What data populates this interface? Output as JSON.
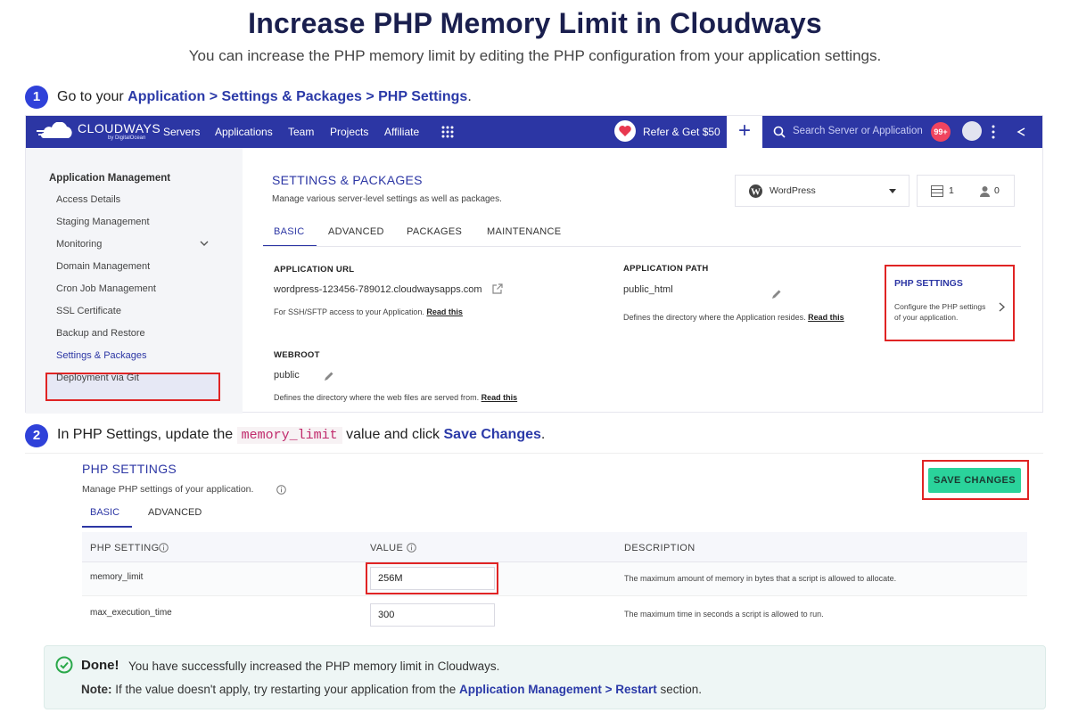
{
  "header": {
    "title": "Increase PHP Memory Limit in Cloudways",
    "subtitle": "You can increase the PHP memory limit by editing the PHP configuration from your application settings."
  },
  "step1": {
    "number": "1",
    "text_prefix": "Go to your ",
    "path": "Application > Settings & Packages > PHP Settings",
    "text_suffix": "."
  },
  "navbar": {
    "logo": "CLOUDWAYS",
    "logo_sub": "by DigitalOcean",
    "items": [
      "Servers",
      "Applications",
      "Team",
      "Projects",
      "Affiliate"
    ],
    "refer": "Refer & Get $50",
    "plus": "+",
    "search_placeholder": "Search Server or Application",
    "badge": "99+"
  },
  "sidebar": {
    "heading": "Application Management",
    "items": [
      "Access Details",
      "Staging Management",
      "Monitoring",
      "Domain Management",
      "Cron Job Management",
      "SSL Certificate",
      "Backup and Restore",
      "Settings & Packages",
      "Deployment via Git"
    ]
  },
  "settings": {
    "heading": "SETTINGS & PACKAGES",
    "description": "Manage various server-level settings as well as packages.",
    "app_select": "WordPress",
    "stat_count_1": "1",
    "stat_count_2": "0",
    "tabs": [
      "BASIC",
      "ADVANCED",
      "PACKAGES",
      "MAINTENANCE"
    ],
    "app_url_label": "APPLICATION URL",
    "app_url_value": "wordpress-123456-789012.cloudwaysapps.com",
    "app_url_help": "For SSH/SFTP access to your Application.",
    "app_path_label": "APPLICATION PATH",
    "app_path_value": "public_html",
    "app_path_help": "Defines the directory where the Application resides.",
    "webroot_label": "WEBROOT",
    "webroot_value": "public",
    "webroot_help": "Defines the directory where the web files are served from.",
    "read_this": "Read this",
    "php_card_title": "PHP SETTINGS",
    "php_card_desc_1": "Configure the PHP settings",
    "php_card_desc_2": "of your application."
  },
  "step2": {
    "number": "2",
    "text_prefix": "In PHP Settings, update the ",
    "code": "memory_limit",
    "text_mid": " value and click ",
    "action": "Save Changes",
    "text_suffix": "."
  },
  "php_settings": {
    "heading": "PHP SETTINGS",
    "description": "Manage PHP settings of your application.",
    "save_label": "SAVE CHANGES",
    "tabs": [
      "BASIC",
      "ADVANCED"
    ],
    "columns": [
      "PHP SETTING",
      "VALUE",
      "DESCRIPTION"
    ],
    "rows": [
      {
        "setting": "memory_limit",
        "value": "256M",
        "description": "The maximum amount of memory in bytes that a script is allowed to allocate."
      },
      {
        "setting": "max_execution_time",
        "value": "300",
        "description": "The maximum time in seconds a script is allowed to run."
      }
    ]
  },
  "done": {
    "title": "Done!",
    "message": "You have successfully increased the PHP memory limit in Cloudways.",
    "note_label": "Note:",
    "note_prefix": "If the value doesn't apply, try restarting your application from the ",
    "note_link": "Application Management > Restart",
    "note_suffix": " section."
  },
  "colors": {
    "navbar": "#2c36a4",
    "step_badge": "#2f41d9",
    "highlight": "#e02424",
    "save_button": "#2ad39b",
    "done_bg": "#eef6f5"
  }
}
